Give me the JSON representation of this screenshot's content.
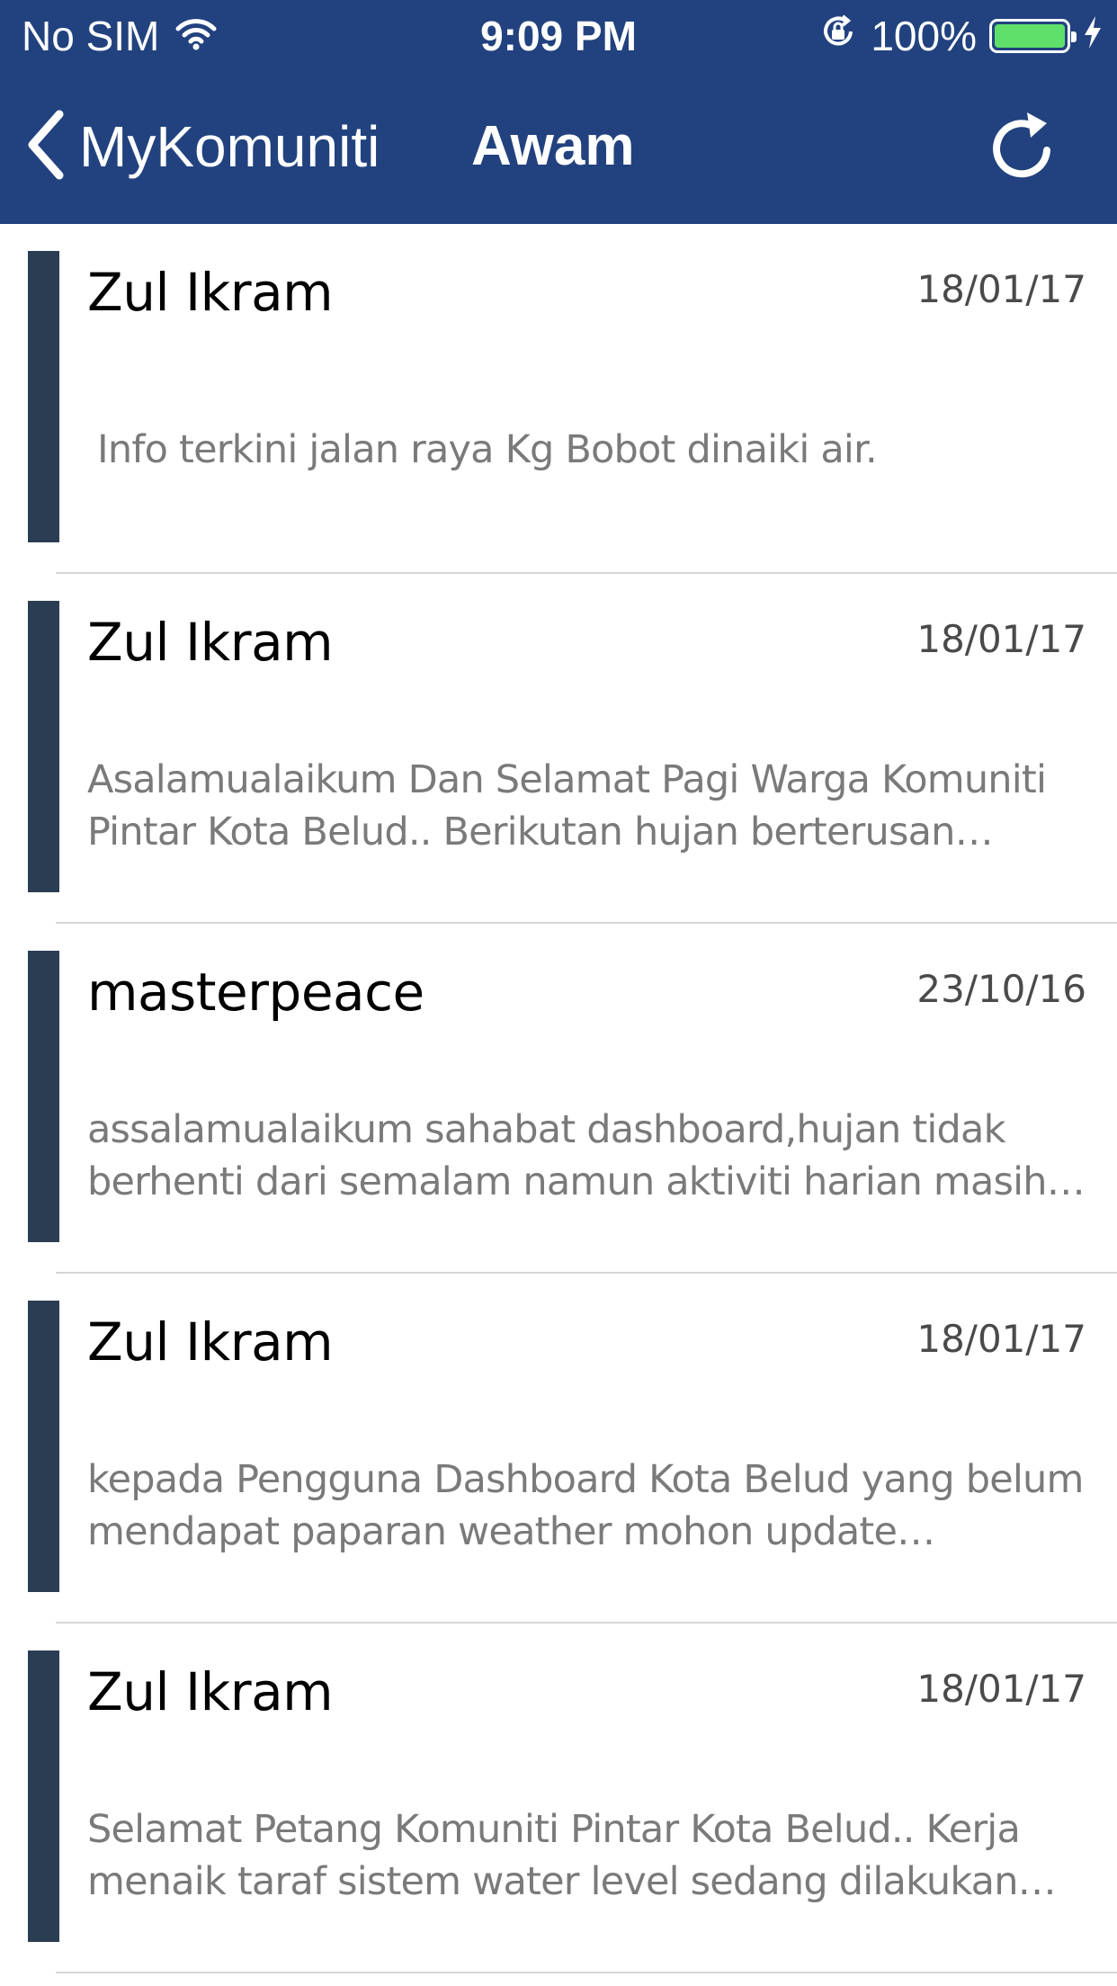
{
  "status_bar": {
    "carrier": "No SIM",
    "time": "9:09 PM",
    "battery_percent": "100%",
    "battery_level": 1.0,
    "battery_color": "#5ee06a",
    "icons": [
      "wifi-icon",
      "orientation-lock-icon",
      "battery-icon",
      "charging-icon"
    ]
  },
  "nav": {
    "back_label": "MyKomuniti",
    "title": "Awam",
    "background": "#22427f",
    "icons": [
      "chevron-left-icon",
      "refresh-icon"
    ]
  },
  "posts": [
    {
      "author": "Zul Ikram",
      "date": "18/01/17",
      "message": " Info terkini jalan raya Kg Bobot dinaiki air."
    },
    {
      "author": "Zul Ikram",
      "date": "18/01/17",
      "message": "Asalamualaikum Dan Selamat Pagi Warga Komuniti Pintar Kota Belud.. Berikutan hujan berterusan mohon b…"
    },
    {
      "author": "masterpeace",
      "date": "23/10/16",
      "message": "assalamualaikum sahabat dashboard,hujan tidak berhenti dari semalam namun aktiviti harian masih berj…"
    },
    {
      "author": "Zul Ikram",
      "date": "18/01/17",
      "message": "kepada Pengguna Dashboard Kota Belud yang belum mendapat paparan weather mohon update Dashboard…"
    },
    {
      "author": "Zul Ikram",
      "date": "18/01/17",
      "message": "Selamat Petang Komuniti Pintar Kota Belud.. Kerja menaik taraf sistem water level sedang dilakukan bagi…"
    }
  ],
  "accent_bar_color": "#2b3d52"
}
